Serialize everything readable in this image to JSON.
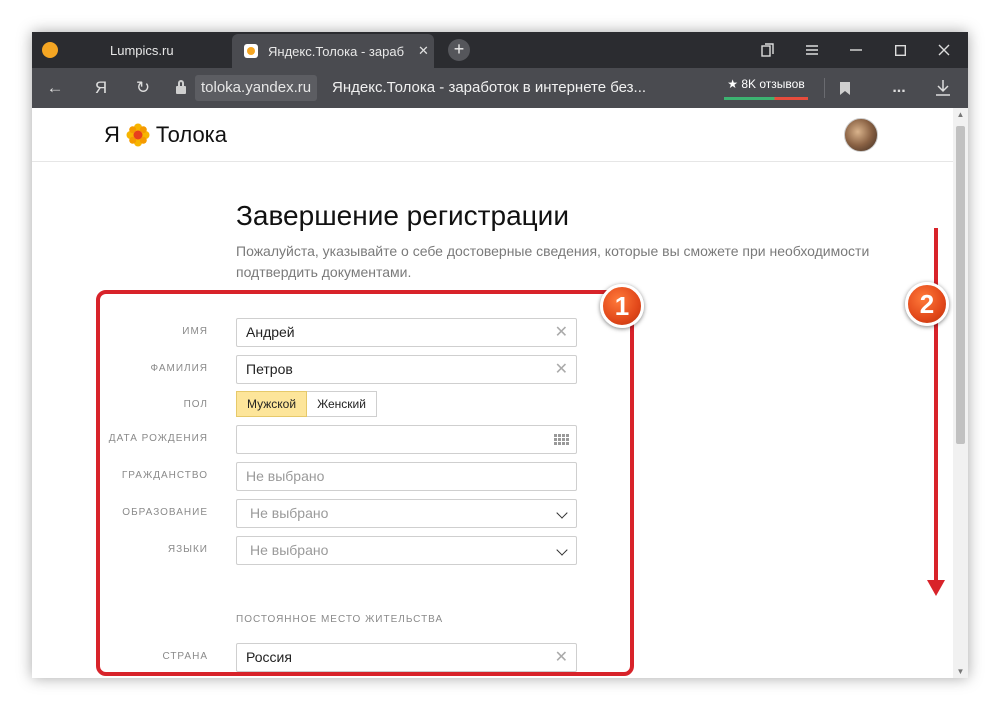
{
  "browser": {
    "tabs": [
      {
        "label": "Lumpics.ru"
      },
      {
        "label": "Яндекс.Толока - зараб"
      }
    ],
    "new_tab": "+",
    "toolbar": {
      "back": "←",
      "ya": "Я",
      "reload": "↻",
      "domain": "toloka.yandex.ru",
      "page_title": "Яндекс.Толока - заработок в интернете без...",
      "reviews": "★ 8K отзывов",
      "more": "...",
      "download": "⭳"
    }
  },
  "site": {
    "logo_ya": "Я",
    "logo_name": "Толока"
  },
  "form": {
    "title": "Завершение регистрации",
    "subtitle": "Пожалуйста, указывайте о себе достоверные сведения, которые вы сможете при необходимости подтвердить документами.",
    "fields": {
      "first_name": {
        "label": "ИМЯ",
        "value": "Андрей"
      },
      "last_name": {
        "label": "ФАМИЛИЯ",
        "value": "Петров"
      },
      "gender": {
        "label": "ПОЛ",
        "options": [
          "Мужской",
          "Женский"
        ],
        "selected": "Мужской"
      },
      "birth_date": {
        "label": "ДАТА РОЖДЕНИЯ",
        "value": ""
      },
      "citizenship": {
        "label": "ГРАЖДАНСТВО",
        "placeholder": "Не выбрано"
      },
      "education": {
        "label": "ОБРАЗОВАНИЕ",
        "placeholder": "Не выбрано"
      },
      "languages": {
        "label": "ЯЗЫКИ",
        "placeholder": "Не выбрано"
      },
      "residence_section": "ПОСТОЯННОЕ МЕСТО ЖИТЕЛЬСТВА",
      "country": {
        "label": "СТРАНА",
        "value": "Россия"
      }
    }
  },
  "annotations": {
    "badge_1": "1",
    "badge_2": "2",
    "color": "#d8232a"
  }
}
